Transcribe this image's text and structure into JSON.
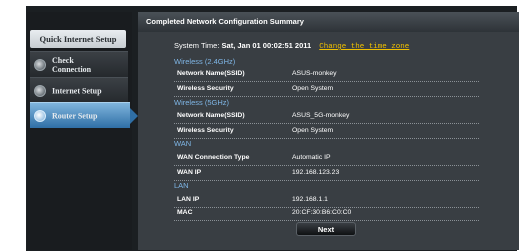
{
  "header": {
    "title": "Completed Network Configuration Summary"
  },
  "sidebar": {
    "heading": "Quick Internet Setup",
    "items": [
      {
        "label_line1": "Check",
        "label_line2": "Connection",
        "icon": "gear-icon"
      },
      {
        "label_line1": "Internet Setup",
        "label_line2": "",
        "icon": "globe-icon"
      },
      {
        "label_line1": "Router Setup",
        "label_line2": "",
        "icon": "router-icon",
        "active": true
      }
    ]
  },
  "system_time": {
    "label": "System Time:",
    "value": "Sat, Jan 01 00:02:51 2011",
    "link": "Change the time zone"
  },
  "sections": {
    "wireless_24": {
      "title": "Wireless (2.4GHz)",
      "ssid_label": "Network Name(SSID)",
      "ssid_value": "ASUS-monkey",
      "security_label": "Wireless Security",
      "security_value": "Open System"
    },
    "wireless_5": {
      "title": "Wireless (5GHz)",
      "ssid_label": "Network Name(SSID)",
      "ssid_value": "ASUS_5G-monkey",
      "security_label": "Wireless Security",
      "security_value": "Open System"
    },
    "wan": {
      "title": "WAN",
      "type_label": "WAN Connection Type",
      "type_value": "Automatic IP",
      "ip_label": "WAN IP",
      "ip_value": "192.168.123.23"
    },
    "lan": {
      "title": "LAN",
      "ip_label": "LAN IP",
      "ip_value": "192.168.1.1",
      "mac_label": "MAC",
      "mac_value": "20:CF:30:B6:C0:C0"
    }
  },
  "actions": {
    "next_label": "Next"
  }
}
